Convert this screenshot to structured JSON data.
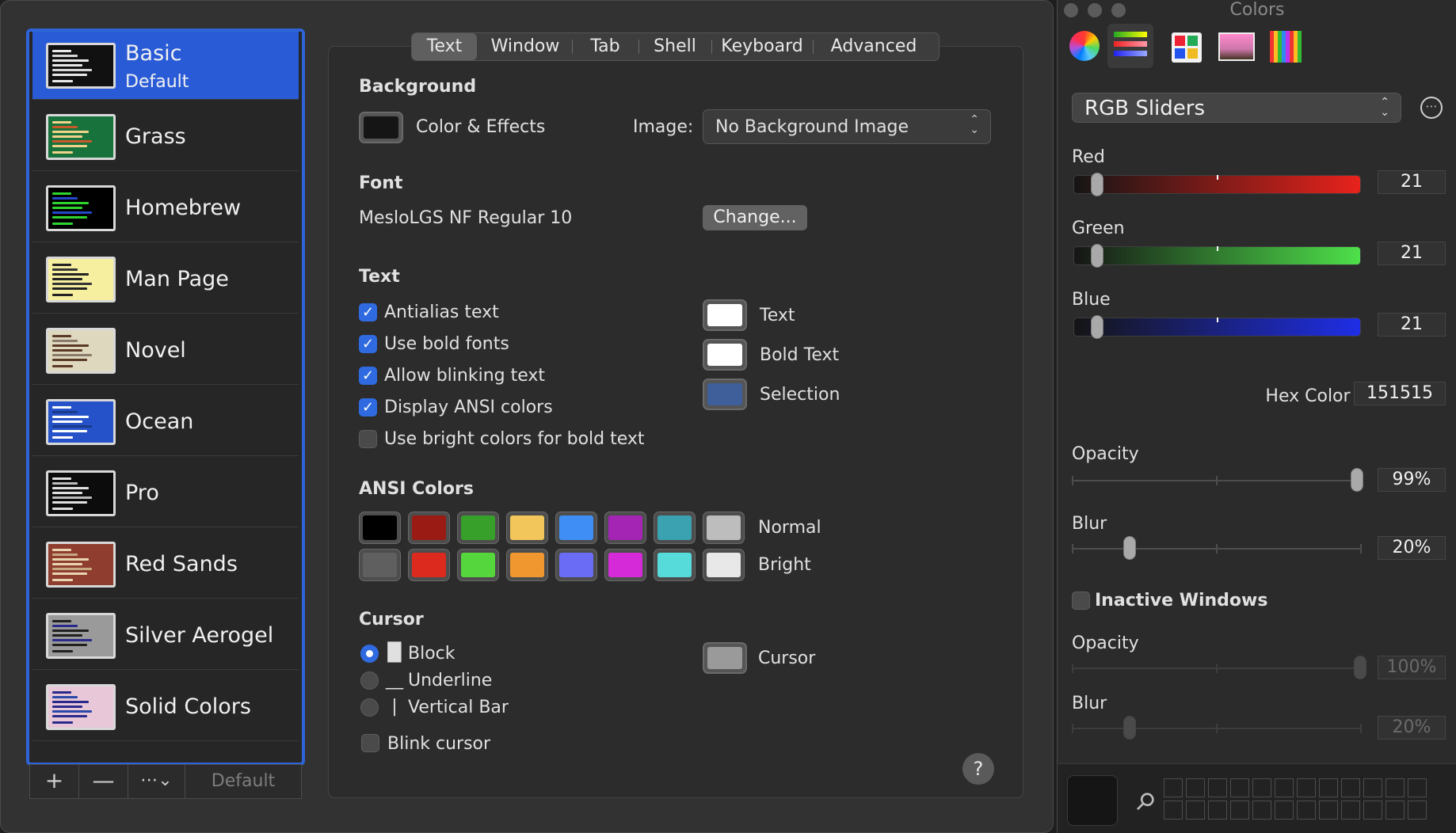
{
  "profiles": [
    {
      "name": "Basic",
      "subtitle": "Default",
      "theme": {
        "bg": "#111111",
        "fg": "#e8e8e8",
        "hi": "#d8d8d8"
      }
    },
    {
      "name": "Grass",
      "theme": {
        "bg": "#17723c",
        "fg": "#f0d28a",
        "hi": "#c85a2a"
      }
    },
    {
      "name": "Homebrew",
      "theme": {
        "bg": "#000000",
        "fg": "#2fd52f",
        "hi": "#2548c8"
      }
    },
    {
      "name": "Man Page",
      "theme": {
        "bg": "#f6efa0",
        "fg": "#222222",
        "hi": "#333333"
      }
    },
    {
      "name": "Novel",
      "theme": {
        "bg": "#ded8be",
        "fg": "#5a3a25",
        "hi": "#8a7a6a"
      }
    },
    {
      "name": "Ocean",
      "theme": {
        "bg": "#2552c8",
        "fg": "#ffffff",
        "hi": "#1a3a8a"
      }
    },
    {
      "name": "Pro",
      "theme": {
        "bg": "#0c0c0c",
        "fg": "#e0e0e0",
        "hi": "#bbbbbb"
      }
    },
    {
      "name": "Red Sands",
      "theme": {
        "bg": "#8e3d2e",
        "fg": "#e8d5b0",
        "hi": "#c8a880"
      }
    },
    {
      "name": "Silver Aerogel",
      "theme": {
        "bg": "#9a9a9a",
        "fg": "#202020",
        "hi": "#2a2a8a"
      }
    },
    {
      "name": "Solid Colors",
      "theme": {
        "bg": "#e8c8d8",
        "fg": "#2a2a8a",
        "hi": "#2a48a8"
      }
    }
  ],
  "profile_bar": {
    "add": "+",
    "remove": "—",
    "more": "⋯⌄",
    "default": "Default"
  },
  "tabs": [
    "Text",
    "Window",
    "Tab",
    "Shell",
    "Keyboard",
    "Advanced"
  ],
  "selected_tab": "Text",
  "background": {
    "heading": "Background",
    "color_effects_label": "Color & Effects",
    "image_label": "Image:",
    "image_value": "No Background Image",
    "swatch_color": "#151515"
  },
  "font": {
    "heading": "Font",
    "value": "MesloLGS NF Regular 10",
    "change_button": "Change..."
  },
  "text": {
    "heading": "Text",
    "options": [
      {
        "label": "Antialias text",
        "checked": true
      },
      {
        "label": "Use bold fonts",
        "checked": true
      },
      {
        "label": "Allow blinking text",
        "checked": true
      },
      {
        "label": "Display ANSI colors",
        "checked": true
      },
      {
        "label": "Use bright colors for bold text",
        "checked": false
      }
    ],
    "color_wells": [
      {
        "label": "Text",
        "color": "#ffffff"
      },
      {
        "label": "Bold Text",
        "color": "#ffffff"
      },
      {
        "label": "Selection",
        "color": "#3f5f9a"
      }
    ]
  },
  "ansi": {
    "heading": "ANSI Colors",
    "normal_label": "Normal",
    "bright_label": "Bright",
    "normal": [
      "#000000",
      "#991b14",
      "#37a02a",
      "#f2c65a",
      "#3f8ef5",
      "#a424b4",
      "#3aa2b0",
      "#bdbdbd"
    ],
    "bright": [
      "#5f5f5f",
      "#dc2a1e",
      "#55d63c",
      "#f0982f",
      "#6a6cf5",
      "#d42ad8",
      "#56dada",
      "#e8e8e8"
    ]
  },
  "cursor": {
    "heading": "Cursor",
    "styles": [
      {
        "label": "Block",
        "glyph": "█",
        "selected": true
      },
      {
        "label": "Underline",
        "glyph": "__",
        "selected": false
      },
      {
        "label": "Vertical Bar",
        "glyph": "|",
        "selected": false
      }
    ],
    "blink_label": "Blink cursor",
    "blink_checked": false,
    "well_label": "Cursor",
    "well_color": "#9a9a9a"
  },
  "help": "?",
  "colors_panel": {
    "title": "Colors",
    "mode": "RGB Sliders",
    "channels": [
      {
        "label": "Red",
        "value": "21",
        "fraction": 0.082
      },
      {
        "label": "Green",
        "value": "21",
        "fraction": 0.082
      },
      {
        "label": "Blue",
        "value": "21",
        "fraction": 0.082
      }
    ],
    "hex_label": "Hex Color #",
    "hex_value": "151515",
    "opacity_label": "Opacity",
    "opacity_value": "99%",
    "opacity_fraction": 0.99,
    "blur_label": "Blur",
    "blur_value": "20%",
    "blur_fraction": 0.2,
    "inactive_label": "Inactive Windows",
    "inactive_checked": false,
    "inactive_opacity_label": "Opacity",
    "inactive_opacity_value": "100%",
    "inactive_opacity_fraction": 1.0,
    "inactive_blur_label": "Blur",
    "inactive_blur_value": "20%",
    "inactive_blur_fraction": 0.2,
    "current_color": "#151515"
  }
}
